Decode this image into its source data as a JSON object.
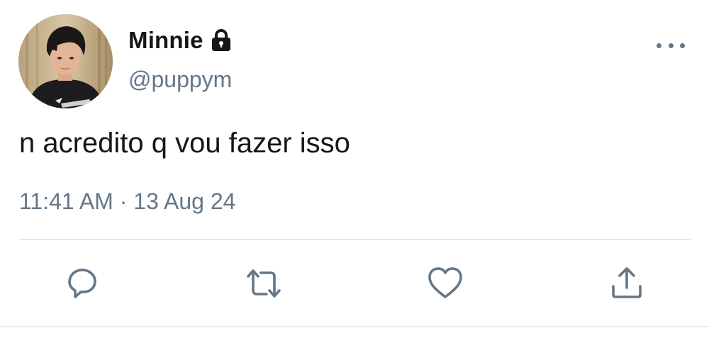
{
  "tweet": {
    "author": {
      "display_name": "Minnie",
      "handle": "@puppym",
      "protected_icon": "lock-icon",
      "avatar_icon": "avatar-photo"
    },
    "text": "n acredito q vou fazer isso",
    "time": "11:41 AM",
    "separator": " · ",
    "date": "13 Aug 24",
    "more_icon": "more-dots-icon"
  },
  "actions": [
    {
      "name": "reply",
      "icon": "reply-bubble-icon"
    },
    {
      "name": "retweet",
      "icon": "retweet-icon"
    },
    {
      "name": "like",
      "icon": "heart-icon"
    },
    {
      "name": "share",
      "icon": "share-icon"
    }
  ],
  "colors": {
    "text_primary": "#14171a",
    "text_secondary": "#657786",
    "divider": "#e1e8ed"
  }
}
